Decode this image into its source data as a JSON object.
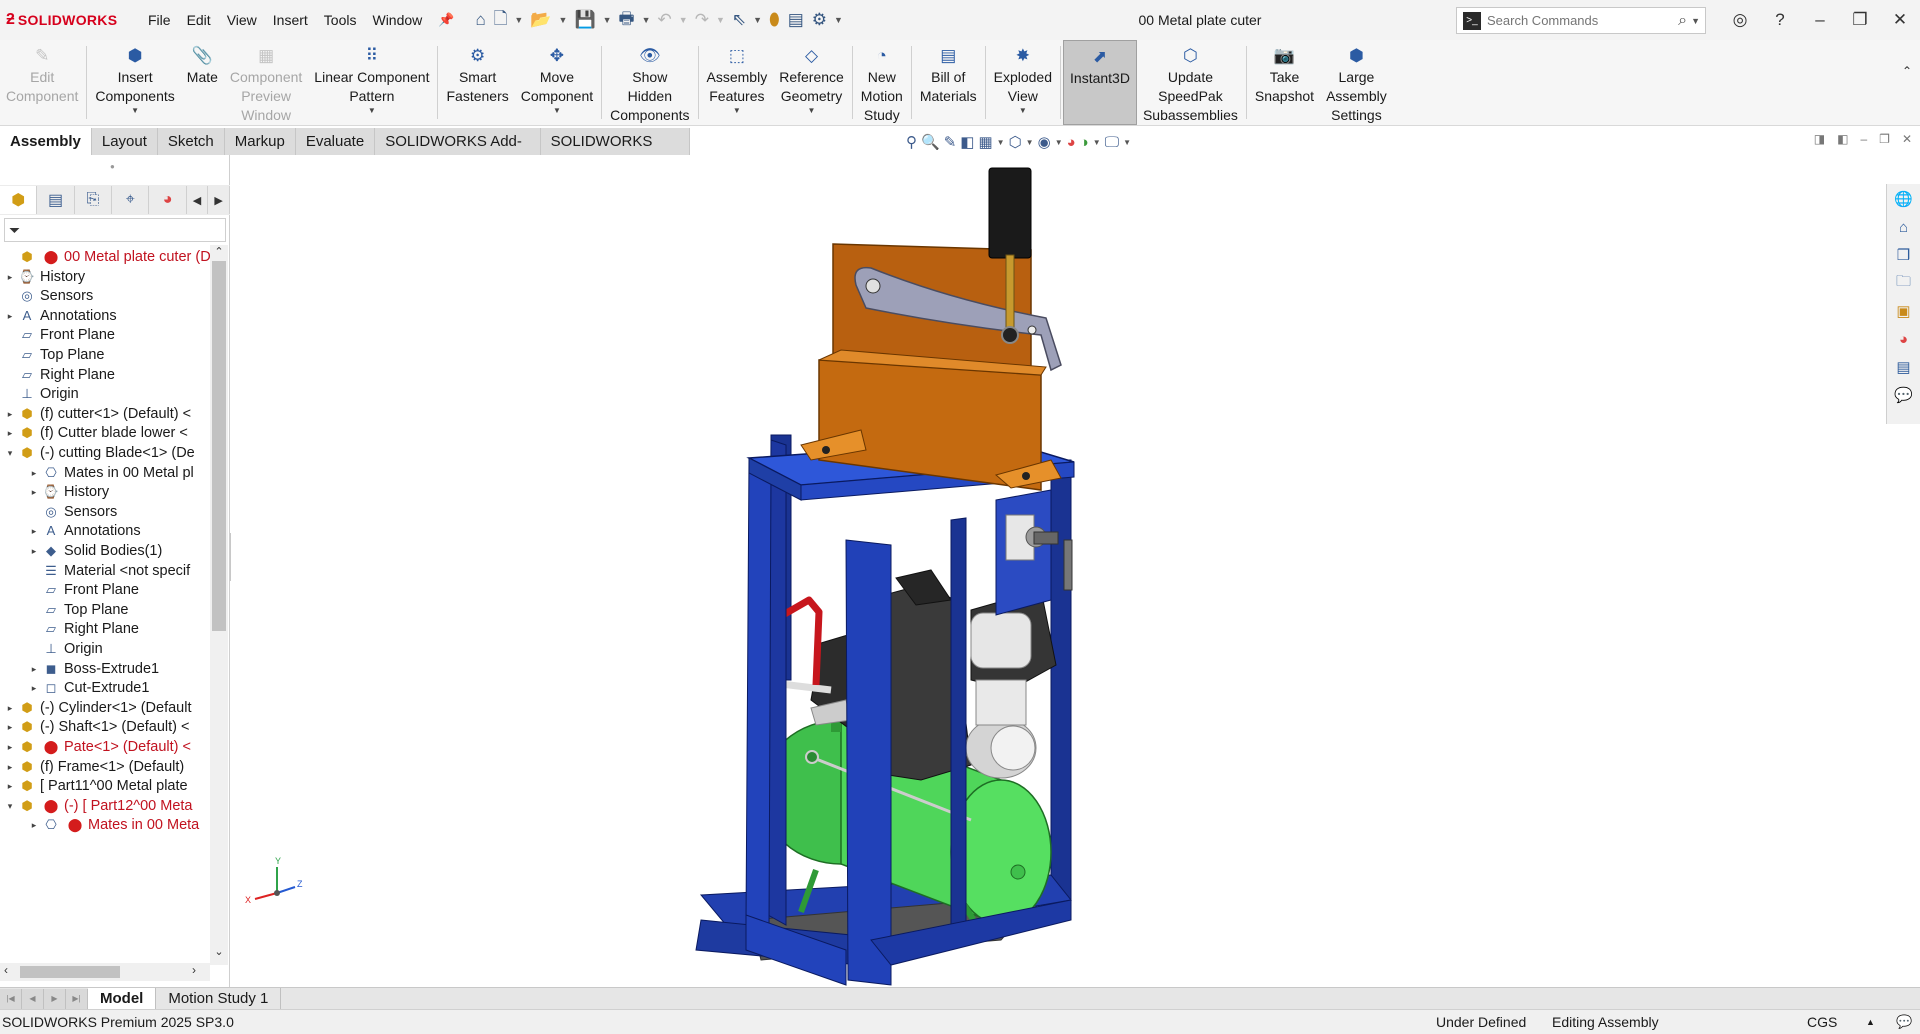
{
  "app": {
    "brand": "SOLIDWORKS",
    "doc_title": "00 Metal plate cuter",
    "menus": [
      "File",
      "Edit",
      "View",
      "Insert",
      "Tools",
      "Window"
    ],
    "search_placeholder": "Search Commands"
  },
  "commands": [
    {
      "label": "Edit\nComponent",
      "icon": "edit-component-icon",
      "enabled": false
    },
    {
      "label": "Insert\nComponents",
      "icon": "insert-components-icon",
      "enabled": true,
      "dropdown": true
    },
    {
      "label": "Mate",
      "icon": "mate-icon",
      "enabled": true
    },
    {
      "label": "Component\nPreview\nWindow",
      "icon": "preview-window-icon",
      "enabled": false
    },
    {
      "label": "Linear Component\nPattern",
      "icon": "linear-pattern-icon",
      "enabled": true,
      "dropdown": true
    },
    {
      "label": "Smart\nFasteners",
      "icon": "smart-fasteners-icon",
      "enabled": true
    },
    {
      "label": "Move\nComponent",
      "icon": "move-component-icon",
      "enabled": true,
      "dropdown": true
    },
    {
      "label": "Show\nHidden\nComponents",
      "icon": "show-hidden-icon",
      "enabled": true
    },
    {
      "label": "Assembly\nFeatures",
      "icon": "assembly-features-icon",
      "enabled": true,
      "dropdown": true
    },
    {
      "label": "Reference\nGeometry",
      "icon": "reference-geometry-icon",
      "enabled": true,
      "dropdown": true
    },
    {
      "label": "New\nMotion\nStudy",
      "icon": "motion-study-icon",
      "enabled": true
    },
    {
      "label": "Bill of\nMaterials",
      "icon": "bom-icon",
      "enabled": true
    },
    {
      "label": "Exploded\nView",
      "icon": "exploded-view-icon",
      "enabled": true,
      "dropdown": true
    },
    {
      "label": "Instant3D",
      "icon": "instant3d-icon",
      "enabled": true,
      "active": true
    },
    {
      "label": "Update\nSpeedPak\nSubassemblies",
      "icon": "speedpak-icon",
      "enabled": true
    },
    {
      "label": "Take\nSnapshot",
      "icon": "snapshot-icon",
      "enabled": true
    },
    {
      "label": "Large\nAssembly\nSettings",
      "icon": "large-assembly-icon",
      "enabled": true
    }
  ],
  "cm_tabs": [
    "Assembly",
    "Layout",
    "Sketch",
    "Markup",
    "Evaluate",
    "SOLIDWORKS Add-Ins",
    "SOLIDWORKS CAM"
  ],
  "active_cm_tab": "Assembly",
  "tree": [
    {
      "depth": 0,
      "exp": "",
      "icon": "part",
      "err": true,
      "label": "00 Metal plate cuter  (D",
      "red": true
    },
    {
      "depth": 1,
      "exp": "▸",
      "icon": "history",
      "label": "History"
    },
    {
      "depth": 1,
      "exp": "",
      "icon": "sensors",
      "label": "Sensors"
    },
    {
      "depth": 1,
      "exp": "▸",
      "icon": "annotations",
      "label": "Annotations"
    },
    {
      "depth": 1,
      "exp": "",
      "icon": "plane",
      "label": "Front Plane"
    },
    {
      "depth": 1,
      "exp": "",
      "icon": "plane",
      "label": "Top Plane"
    },
    {
      "depth": 1,
      "exp": "",
      "icon": "plane",
      "label": "Right Plane"
    },
    {
      "depth": 1,
      "exp": "",
      "icon": "origin",
      "label": "Origin"
    },
    {
      "depth": 1,
      "exp": "▸",
      "icon": "part",
      "label": "(f) cutter<1> (Default) <"
    },
    {
      "depth": 1,
      "exp": "▸",
      "icon": "part",
      "label": "(f) Cutter blade lower <"
    },
    {
      "depth": 1,
      "exp": "▾",
      "icon": "part",
      "label": "(-) cutting Blade<1> (De"
    },
    {
      "depth": 2,
      "exp": "▸",
      "icon": "mates",
      "label": "Mates in 00 Metal pl"
    },
    {
      "depth": 2,
      "exp": "▸",
      "icon": "history",
      "label": "History"
    },
    {
      "depth": 2,
      "exp": "",
      "icon": "sensors",
      "label": "Sensors"
    },
    {
      "depth": 2,
      "exp": "▸",
      "icon": "annotations",
      "label": "Annotations"
    },
    {
      "depth": 2,
      "exp": "▸",
      "icon": "bodies",
      "label": "Solid Bodies(1)"
    },
    {
      "depth": 2,
      "exp": "",
      "icon": "material",
      "label": "Material <not specif"
    },
    {
      "depth": 2,
      "exp": "",
      "icon": "plane",
      "label": "Front Plane"
    },
    {
      "depth": 2,
      "exp": "",
      "icon": "plane",
      "label": "Top Plane"
    },
    {
      "depth": 2,
      "exp": "",
      "icon": "plane",
      "label": "Right Plane"
    },
    {
      "depth": 2,
      "exp": "",
      "icon": "origin",
      "label": "Origin"
    },
    {
      "depth": 2,
      "exp": "▸",
      "icon": "extrude",
      "label": "Boss-Extrude1"
    },
    {
      "depth": 2,
      "exp": "▸",
      "icon": "cut",
      "label": "Cut-Extrude1"
    },
    {
      "depth": 1,
      "exp": "▸",
      "icon": "part",
      "label": "(-) Cylinder<1> (Default"
    },
    {
      "depth": 1,
      "exp": "▸",
      "icon": "part",
      "label": "(-) Shaft<1> (Default) <"
    },
    {
      "depth": 1,
      "exp": "▸",
      "icon": "part",
      "err": true,
      "label": "Pate<1> (Default) <",
      "red": true
    },
    {
      "depth": 1,
      "exp": "▸",
      "icon": "part",
      "label": "(f) Frame<1> (Default)"
    },
    {
      "depth": 1,
      "exp": "▸",
      "icon": "part",
      "label": "[ Part11^00 Metal plate"
    },
    {
      "depth": 1,
      "exp": "▾",
      "icon": "part",
      "err": true,
      "label": "(-) [ Part12^00 Meta",
      "red": true
    },
    {
      "depth": 2,
      "exp": "▸",
      "icon": "mates",
      "err": true,
      "label": "Mates in 00 Meta",
      "red": true
    }
  ],
  "bottom_tabs": [
    "Model",
    "Motion Study 1"
  ],
  "active_bottom_tab": "Model",
  "status": {
    "version": "SOLIDWORKS Premium 2025 SP3.0",
    "definition": "Under Defined",
    "mode": "Editing Assembly",
    "units": "CGS"
  },
  "triad": {
    "x": "X",
    "y": "Y",
    "z": "Z"
  },
  "colors": {
    "brand": "#d6001c",
    "frame": "#1e3a9a",
    "top_plate": "#2b55d6",
    "blade_holder": "#c46a10",
    "tank": "#4fd65a",
    "engine": "#3a3a3a"
  }
}
